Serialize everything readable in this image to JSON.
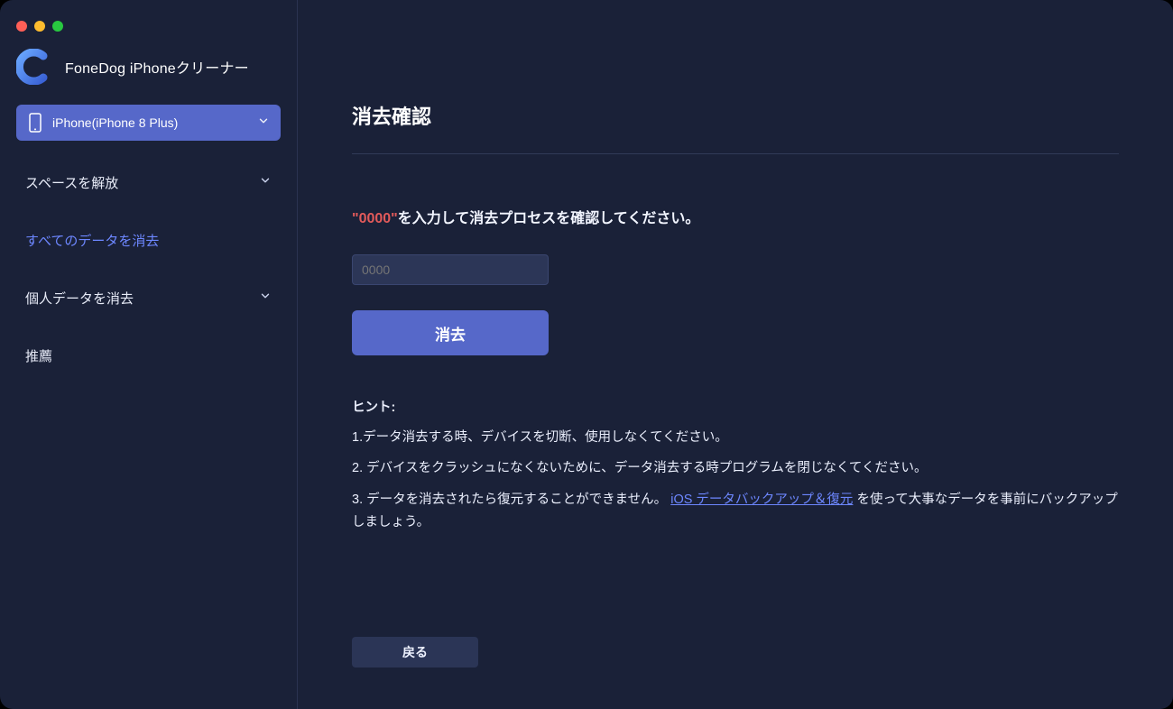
{
  "app": {
    "title": "FoneDog iPhoneクリーナー"
  },
  "sidebar": {
    "device_label": "iPhone(iPhone 8 Plus)",
    "items": [
      {
        "label": "スペースを解放",
        "has_chevron": true
      },
      {
        "label": "すべてのデータを消去",
        "selected": true
      },
      {
        "label": "個人データを消去",
        "has_chevron": true
      },
      {
        "label": "推薦"
      }
    ]
  },
  "main": {
    "title": "消去確認",
    "instruction_code": "\"0000\"",
    "instruction_rest": "を入力して消去プロセスを確認してください。",
    "input_placeholder": "0000",
    "erase_label": "消去",
    "hints": {
      "title": "ヒント:",
      "line1": "1.データ消去する時、デバイスを切断、使用しなくてください。",
      "line2": "2. デバイスをクラッシュになくないために、データ消去する時プログラムを閉じなくてください。",
      "line3_pre": "3. データを消去されたら復元することができません。",
      "line3_link": "iOS データバックアップ＆復元",
      "line3_post": " を使って大事なデータを事前にバックアップしましょう。"
    },
    "back_label": "戻る"
  }
}
